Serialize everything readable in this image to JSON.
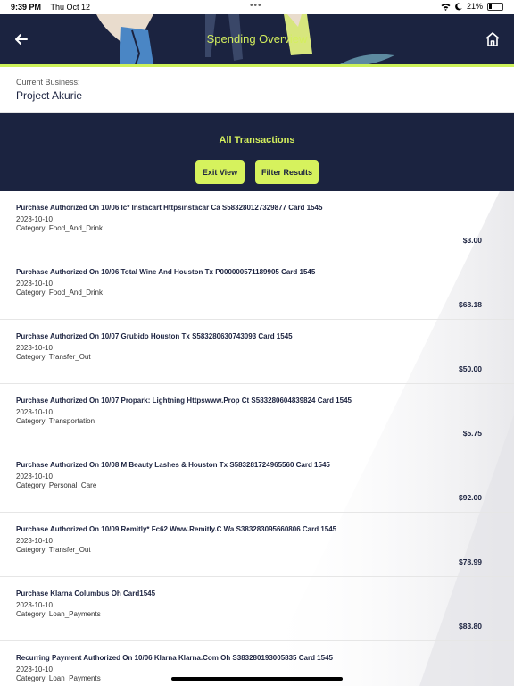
{
  "status_bar": {
    "time": "9:39 PM",
    "date": "Thu Oct 12",
    "battery": "21%",
    "battery_level": 0.21
  },
  "header": {
    "title": "Spending Overview"
  },
  "business": {
    "label": "Current Business:",
    "name": "Project Akurie"
  },
  "panel": {
    "heading": "All Transactions",
    "exit_label": "Exit View",
    "filter_label": "Filter Results"
  },
  "colors": {
    "navy": "#1b2340",
    "accent": "#d4ef5d",
    "button": "#d6f25d"
  },
  "transactions": [
    {
      "description": "Purchase Authorized On 10/06 Ic* Instacart Httpsinstacar Ca S583280127329877 Card 1545",
      "date": "2023-10-10",
      "category": "Category: Food_And_Drink",
      "amount": "$3.00"
    },
    {
      "description": "Purchase Authorized On 10/06 Total Wine And Houston Tx P000000571189905 Card 1545",
      "date": "2023-10-10",
      "category": "Category: Food_And_Drink",
      "amount": "$68.18"
    },
    {
      "description": "Purchase Authorized On 10/07 Grubido Houston Tx S583280630743093 Card 1545",
      "date": "2023-10-10",
      "category": "Category: Transfer_Out",
      "amount": "$50.00"
    },
    {
      "description": "Purchase Authorized On 10/07 Propark: Lightning Httpswww.Prop Ct S583280604839824 Card 1545",
      "date": "2023-10-10",
      "category": "Category: Transportation",
      "amount": "$5.75"
    },
    {
      "description": "Purchase Authorized On 10/08 M Beauty Lashes & Houston Tx S583281724965560 Card 1545",
      "date": "2023-10-10",
      "category": "Category: Personal_Care",
      "amount": "$92.00"
    },
    {
      "description": "Purchase Authorized On 10/09 Remitly* Fc62 Www.Remitly.C Wa S383283095660806 Card 1545",
      "date": "2023-10-10",
      "category": "Category: Transfer_Out",
      "amount": "$78.99"
    },
    {
      "description": "Purchase Klarna Columbus Oh Card1545",
      "date": "2023-10-10",
      "category": "Category: Loan_Payments",
      "amount": "$83.80"
    },
    {
      "description": "Recurring Payment Authorized On 10/06 Klarna Klarna.Com Oh S383280193005835 Card 1545",
      "date": "2023-10-10",
      "category": "Category: Loan_Payments",
      "amount": ""
    }
  ]
}
